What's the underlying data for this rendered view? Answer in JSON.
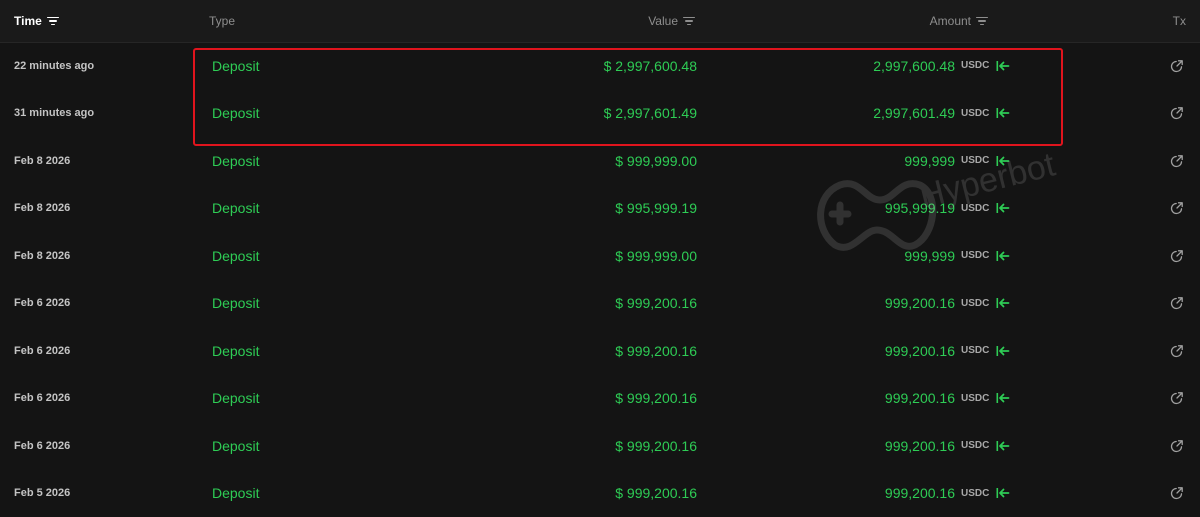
{
  "header": {
    "time": "Time",
    "type": "Type",
    "value": "Value",
    "amount": "Amount",
    "tx": "Tx"
  },
  "rows": [
    {
      "time": "22 minutes ago",
      "type": "Deposit",
      "value": "$ 2,997,600.48",
      "amount": "2,997,600.48",
      "unit": "USDC"
    },
    {
      "time": "31 minutes ago",
      "type": "Deposit",
      "value": "$ 2,997,601.49",
      "amount": "2,997,601.49",
      "unit": "USDC"
    },
    {
      "time": "Feb 8 2026",
      "type": "Deposit",
      "value": "$ 999,999.00",
      "amount": "999,999",
      "unit": "USDC"
    },
    {
      "time": "Feb 8 2026",
      "type": "Deposit",
      "value": "$ 995,999.19",
      "amount": "995,999.19",
      "unit": "USDC"
    },
    {
      "time": "Feb 8 2026",
      "type": "Deposit",
      "value": "$ 999,999.00",
      "amount": "999,999",
      "unit": "USDC"
    },
    {
      "time": "Feb 6 2026",
      "type": "Deposit",
      "value": "$ 999,200.16",
      "amount": "999,200.16",
      "unit": "USDC"
    },
    {
      "time": "Feb 6 2026",
      "type": "Deposit",
      "value": "$ 999,200.16",
      "amount": "999,200.16",
      "unit": "USDC"
    },
    {
      "time": "Feb 6 2026",
      "type": "Deposit",
      "value": "$ 999,200.16",
      "amount": "999,200.16",
      "unit": "USDC"
    },
    {
      "time": "Feb 6 2026",
      "type": "Deposit",
      "value": "$ 999,200.16",
      "amount": "999,200.16",
      "unit": "USDC"
    },
    {
      "time": "Feb 5 2026",
      "type": "Deposit",
      "value": "$ 999,200.16",
      "amount": "999,200.16",
      "unit": "USDC"
    }
  ],
  "watermark": {
    "text": "Hyperbot"
  },
  "icons": {
    "sort": "sort-lines-icon",
    "direction": "arrow-left-bar-icon",
    "tx": "external-link-icon"
  },
  "colors": {
    "background": "#141414",
    "header_background": "#1a1a1a",
    "positive": "#2ecc55",
    "highlight": "#e0141d"
  }
}
